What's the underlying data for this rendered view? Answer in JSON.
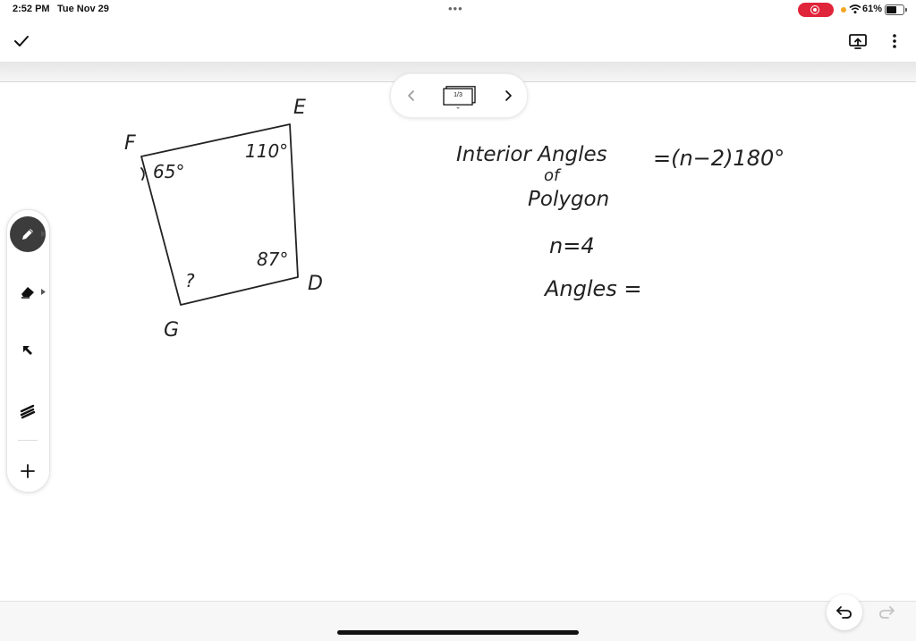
{
  "status_bar": {
    "time": "2:52 PM",
    "date": "Tue Nov 29",
    "battery_percent": "61%",
    "battery_level": 0.61,
    "recording": true
  },
  "toolbar": {
    "done_icon": "checkmark-icon",
    "present_icon": "present-screen-icon",
    "more_icon": "more-vertical-icon"
  },
  "page_nav": {
    "page_label": "1/3",
    "prev_icon": "chevron-left-icon",
    "next_icon": "chevron-right-icon"
  },
  "tools": [
    {
      "name": "pen",
      "icon": "pen-icon",
      "active": true
    },
    {
      "name": "eraser",
      "icon": "eraser-icon",
      "active": false
    },
    {
      "name": "select",
      "icon": "arrow-pointer-icon",
      "active": false
    },
    {
      "name": "laser",
      "icon": "laser-pointer-icon",
      "active": false
    },
    {
      "name": "add",
      "icon": "plus-icon",
      "active": false
    }
  ],
  "handwriting": {
    "vertex_labels": {
      "E": "E",
      "F": "F",
      "G": "G",
      "D": "D"
    },
    "angles": {
      "F": "65°",
      "E": "110°",
      "D": "87°",
      "G": "?"
    },
    "formula_left_line1": "Interior Angles",
    "formula_left_line2": "of",
    "formula_left_line3": "Polygon",
    "formula_right": "=(n−2)180°",
    "n_value": "n=4",
    "angles_eq": "Angles ="
  },
  "colors": {
    "record_red": "#e0243a",
    "mic_orange": "#f5a623",
    "ink": "#222222"
  }
}
